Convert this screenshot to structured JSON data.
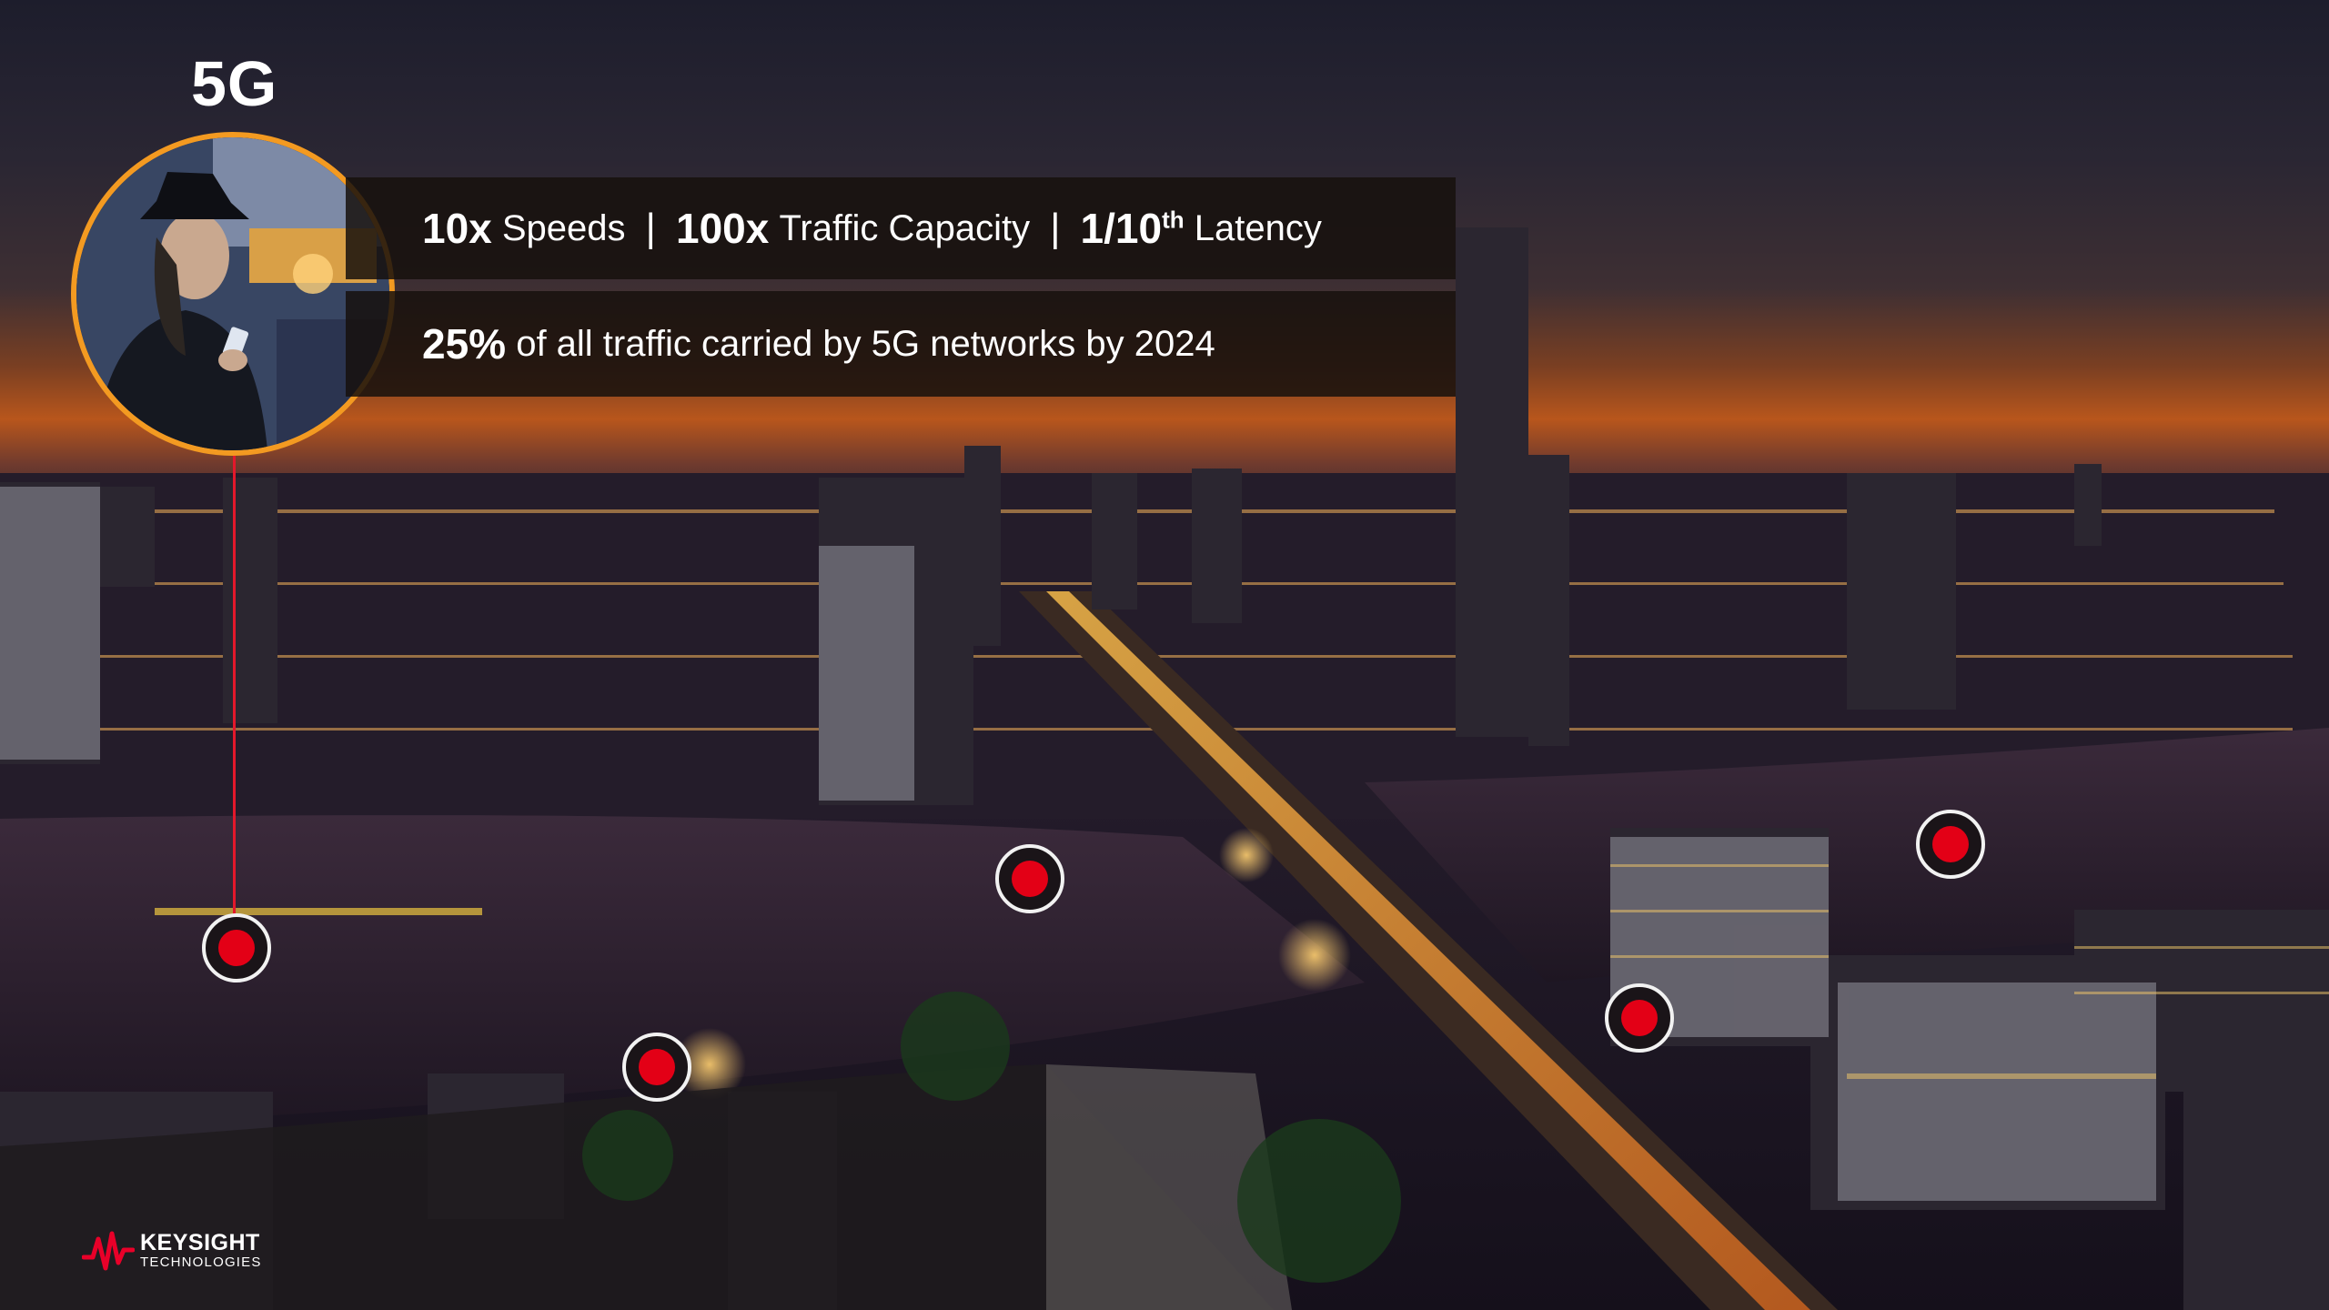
{
  "slide": {
    "title": "5G",
    "stats": {
      "speeds_value": "10x",
      "speeds_label": "Speeds",
      "separator": "|",
      "capacity_value": "100x",
      "capacity_label": "Traffic Capacity",
      "latency_value": "1/10",
      "latency_sup": "th",
      "latency_label": "Latency"
    },
    "traffic": {
      "value": "25%",
      "text": "of all traffic carried by 5G networks by 2024"
    }
  },
  "logo": {
    "name": "KEYSIGHT",
    "sub": "TECHNOLOGIES"
  },
  "colors": {
    "accent_orange": "#f39a21",
    "marker_red": "#e30016",
    "brand_red": "#e90029"
  },
  "icons": [
    "location-marker-icon",
    "keysight-wave-icon"
  ]
}
